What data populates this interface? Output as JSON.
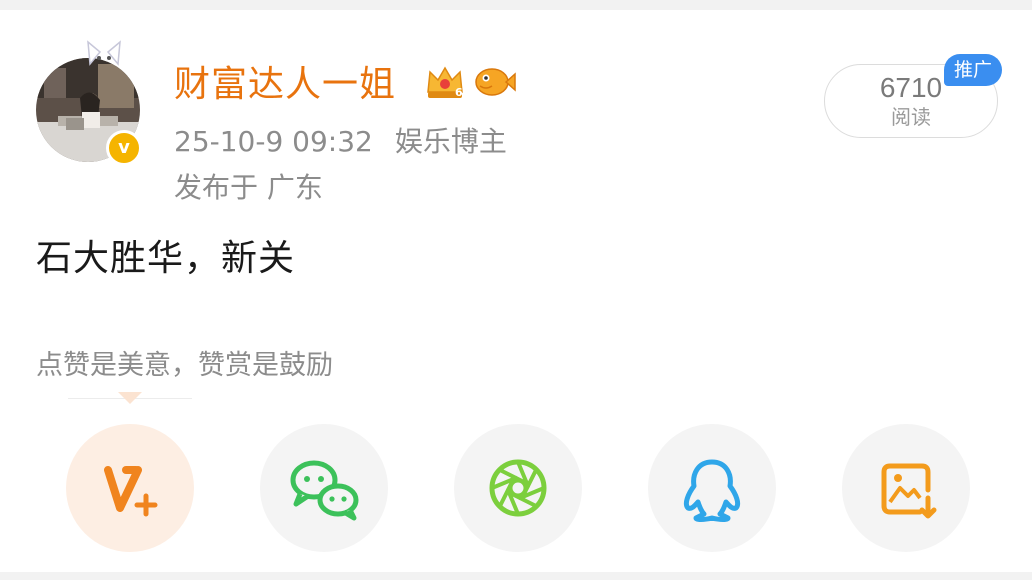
{
  "post": {
    "author": {
      "name": "财富达人一姐",
      "avatar_icon": "avatar-photo",
      "verified_icon": "v-badge",
      "verified_text": "v",
      "badges": [
        "crown-level-6-icon",
        "orange-fish-icon"
      ]
    },
    "meta": {
      "datetime": "25-10-9 09:32",
      "category": "娱乐博主",
      "location": "发布于 广东"
    },
    "stats": {
      "reads_count": "6710",
      "reads_label": "阅读",
      "promo_label": "推广"
    },
    "content": "石大胜华，新关",
    "reward_hint": "点赞是美意，赞赏是鼓励"
  },
  "share": {
    "buttons": [
      {
        "name": "v-plus-button",
        "icon": "v-plus-icon",
        "active": true
      },
      {
        "name": "wechat-button",
        "icon": "wechat-icon",
        "active": false
      },
      {
        "name": "moments-button",
        "icon": "moments-shutter-icon",
        "active": false
      },
      {
        "name": "qq-button",
        "icon": "qq-penguin-icon",
        "active": false
      },
      {
        "name": "save-image-button",
        "icon": "save-image-icon",
        "active": false
      }
    ]
  },
  "colors": {
    "accent_orange": "#e8730e",
    "promo_blue": "#3a8ef0",
    "wechat_green": "#3cc15a",
    "moments_green": "#7ccf3d",
    "qq_blue": "#2fa6e9",
    "save_orange": "#f39b1c"
  }
}
